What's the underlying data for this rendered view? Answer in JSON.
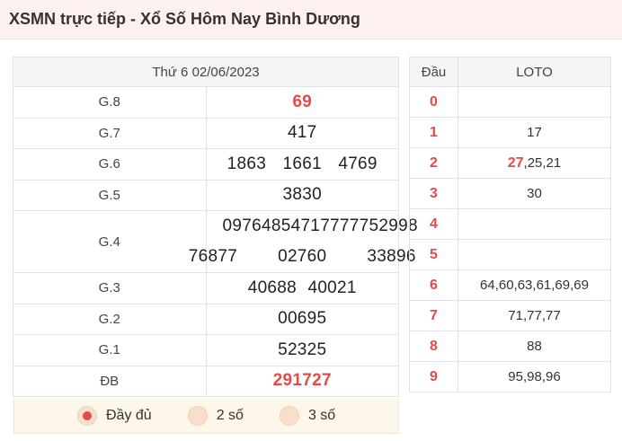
{
  "header": {
    "title": "XSMN trực tiếp - Xổ Số Hôm Nay Bình Dương"
  },
  "results": {
    "date": "Thứ 6 02/06/2023",
    "prizes": [
      {
        "label": "G.8",
        "numbers": [
          "69"
        ]
      },
      {
        "label": "G.7",
        "numbers": [
          "417"
        ]
      },
      {
        "label": "G.6",
        "numbers": [
          "1863",
          "1661",
          "4769"
        ]
      },
      {
        "label": "G.5",
        "numbers": [
          "3830"
        ]
      },
      {
        "label": "G.4",
        "numbers": [
          "09764",
          "85471",
          "77777",
          "52998",
          "76877",
          "02760",
          "33896"
        ]
      },
      {
        "label": "G.3",
        "numbers": [
          "40688",
          "40021"
        ]
      },
      {
        "label": "G.2",
        "numbers": [
          "00695"
        ]
      },
      {
        "label": "G.1",
        "numbers": [
          "52325"
        ]
      },
      {
        "label": "ĐB",
        "numbers": [
          "291727"
        ]
      }
    ]
  },
  "options": {
    "items": [
      {
        "label": "Đầy đủ",
        "selected": true
      },
      {
        "label": "2 số",
        "selected": false
      },
      {
        "label": "3 số",
        "selected": false
      }
    ]
  },
  "loto": {
    "header_dau": "Đầu",
    "header_loto": "LOTO",
    "rows": [
      {
        "dau": "0",
        "hot": "",
        "rest": ""
      },
      {
        "dau": "1",
        "hot": "",
        "rest": "17"
      },
      {
        "dau": "2",
        "hot": "27",
        "rest": ",25,21"
      },
      {
        "dau": "3",
        "hot": "",
        "rest": "30"
      },
      {
        "dau": "4",
        "hot": "",
        "rest": ""
      },
      {
        "dau": "5",
        "hot": "",
        "rest": ""
      },
      {
        "dau": "6",
        "hot": "",
        "rest": "64,60,63,61,69,69"
      },
      {
        "dau": "7",
        "hot": "",
        "rest": "71,77,77"
      },
      {
        "dau": "8",
        "hot": "",
        "rest": "88"
      },
      {
        "dau": "9",
        "hot": "",
        "rest": "95,98,96"
      }
    ]
  },
  "colors": {
    "accent": "#e54b4b",
    "header_bg": "#fdf1ef",
    "options_bg": "#fdf6ea"
  }
}
